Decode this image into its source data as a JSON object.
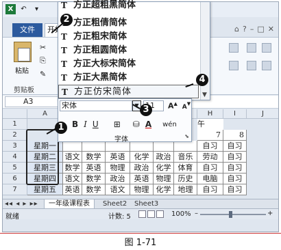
{
  "window": {
    "logo": "X",
    "undo": "↶",
    "undo_menu": "▾",
    "pin": "▾",
    "minimize": "–",
    "restore": "□",
    "close": "✕"
  },
  "ribbon": {
    "file_tab": "文件",
    "home_tab": "开始",
    "paste_label": "粘贴",
    "clipboard_label": "剪贴板",
    "right_icons": [
      "⌂",
      "?",
      "–",
      "□",
      "✕"
    ]
  },
  "formula_bar": {
    "name_box": "A3"
  },
  "font_list": {
    "items": [
      "方正超粗黑简体",
      "方正粗倩简体",
      "方正粗宋简体",
      "方正粗圆简体",
      "方正大标宋简体",
      "方正大黑简体",
      "方正仿宋简体"
    ],
    "icon": "T",
    "highlighted_index": 6
  },
  "mini_toolbar": {
    "font_value": "宋体",
    "font_size": "11",
    "grow": "A",
    "shrink": "A",
    "bold": "B",
    "italic": "I",
    "underline": "U",
    "font_group_label": "字体"
  },
  "sheet": {
    "columns": [
      "A",
      "B",
      "C",
      "D",
      "E",
      "F",
      "G",
      "H",
      "I",
      "J"
    ],
    "row_numbers": [
      "1",
      "2",
      "3",
      "4",
      "5",
      "6",
      "7"
    ],
    "row1_visible": "午",
    "header_row": [
      "7",
      "8"
    ],
    "rows": [
      {
        "day": "星期一",
        "classes": [
          "",
          "",
          "",
          "",
          "",
          "",
          "自习",
          "自习"
        ]
      },
      {
        "day": "星期二",
        "classes": [
          "语文",
          "数学",
          "英语",
          "化学",
          "政治",
          "音乐",
          "劳动",
          "自习"
        ]
      },
      {
        "day": "星期三",
        "classes": [
          "数学",
          "英语",
          "物理",
          "政治",
          "化学",
          "体育",
          "自习",
          "自习"
        ]
      },
      {
        "day": "星期四",
        "classes": [
          "语文",
          "数学",
          "政治",
          "英语",
          "物理",
          "历史",
          "电脑",
          "自习"
        ]
      },
      {
        "day": "星期五",
        "classes": [
          "英语",
          "数学",
          "语文",
          "物理",
          "化学",
          "地理",
          "自习",
          "自习"
        ]
      }
    ]
  },
  "sheet_tabs": {
    "nav": "◂◂ ◂ ▸ ▸▸",
    "tab1": "一年级课程表",
    "tab2": "Sheet2",
    "tab3": "Sheet3"
  },
  "status_bar": {
    "ready": "就绪",
    "count": "计数: 5",
    "zoom": "100%",
    "minus": "–",
    "plus": "+"
  },
  "callouts": [
    "1",
    "2",
    "3",
    "4"
  ],
  "caption": "图 1-71"
}
